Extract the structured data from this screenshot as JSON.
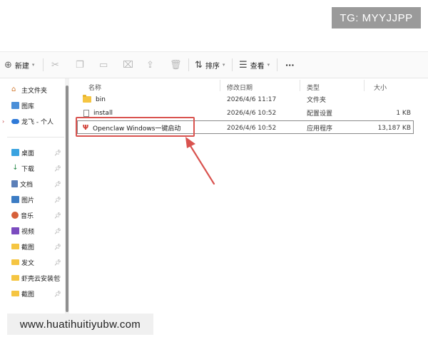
{
  "watermarks": {
    "top_right": "TG: MYYJJPP",
    "bottom_left": "www.huatihuitiyubw.com"
  },
  "toolbar": {
    "new_label": "新建",
    "sort_label": "排序",
    "view_label": "查看",
    "more_label": "···"
  },
  "sidebar": {
    "home": "主文件夹",
    "gallery": "图库",
    "cloud": "龙飞 - 个人",
    "items": [
      {
        "label": "桌面",
        "icon": "desktop-icon"
      },
      {
        "label": "下载",
        "icon": "download-icon"
      },
      {
        "label": "文档",
        "icon": "documents-icon"
      },
      {
        "label": "图片",
        "icon": "pictures-icon"
      },
      {
        "label": "音乐",
        "icon": "music-icon"
      },
      {
        "label": "视频",
        "icon": "videos-icon"
      },
      {
        "label": "截图",
        "icon": "folder-icon"
      },
      {
        "label": "发文",
        "icon": "folder-icon"
      },
      {
        "label": "虾壳云安装包",
        "icon": "folder-icon"
      },
      {
        "label": "截图",
        "icon": "folder-icon"
      }
    ]
  },
  "columns": {
    "name": "名称",
    "modified": "修改日期",
    "type": "类型",
    "size": "大小"
  },
  "files": [
    {
      "name": "bin",
      "modified": "2026/4/6 11:17",
      "type": "文件夹",
      "size": ""
    },
    {
      "name": "install",
      "modified": "2026/4/6 10:52",
      "type": "配置设置",
      "size": "1 KB"
    },
    {
      "name": "Openclaw Windows一键启动",
      "modified": "2026/4/6 10:52",
      "type": "应用程序",
      "size": "13,187 KB"
    }
  ],
  "colors": {
    "annotation_red": "#d9534f",
    "folder_yellow": "#f5c542"
  }
}
